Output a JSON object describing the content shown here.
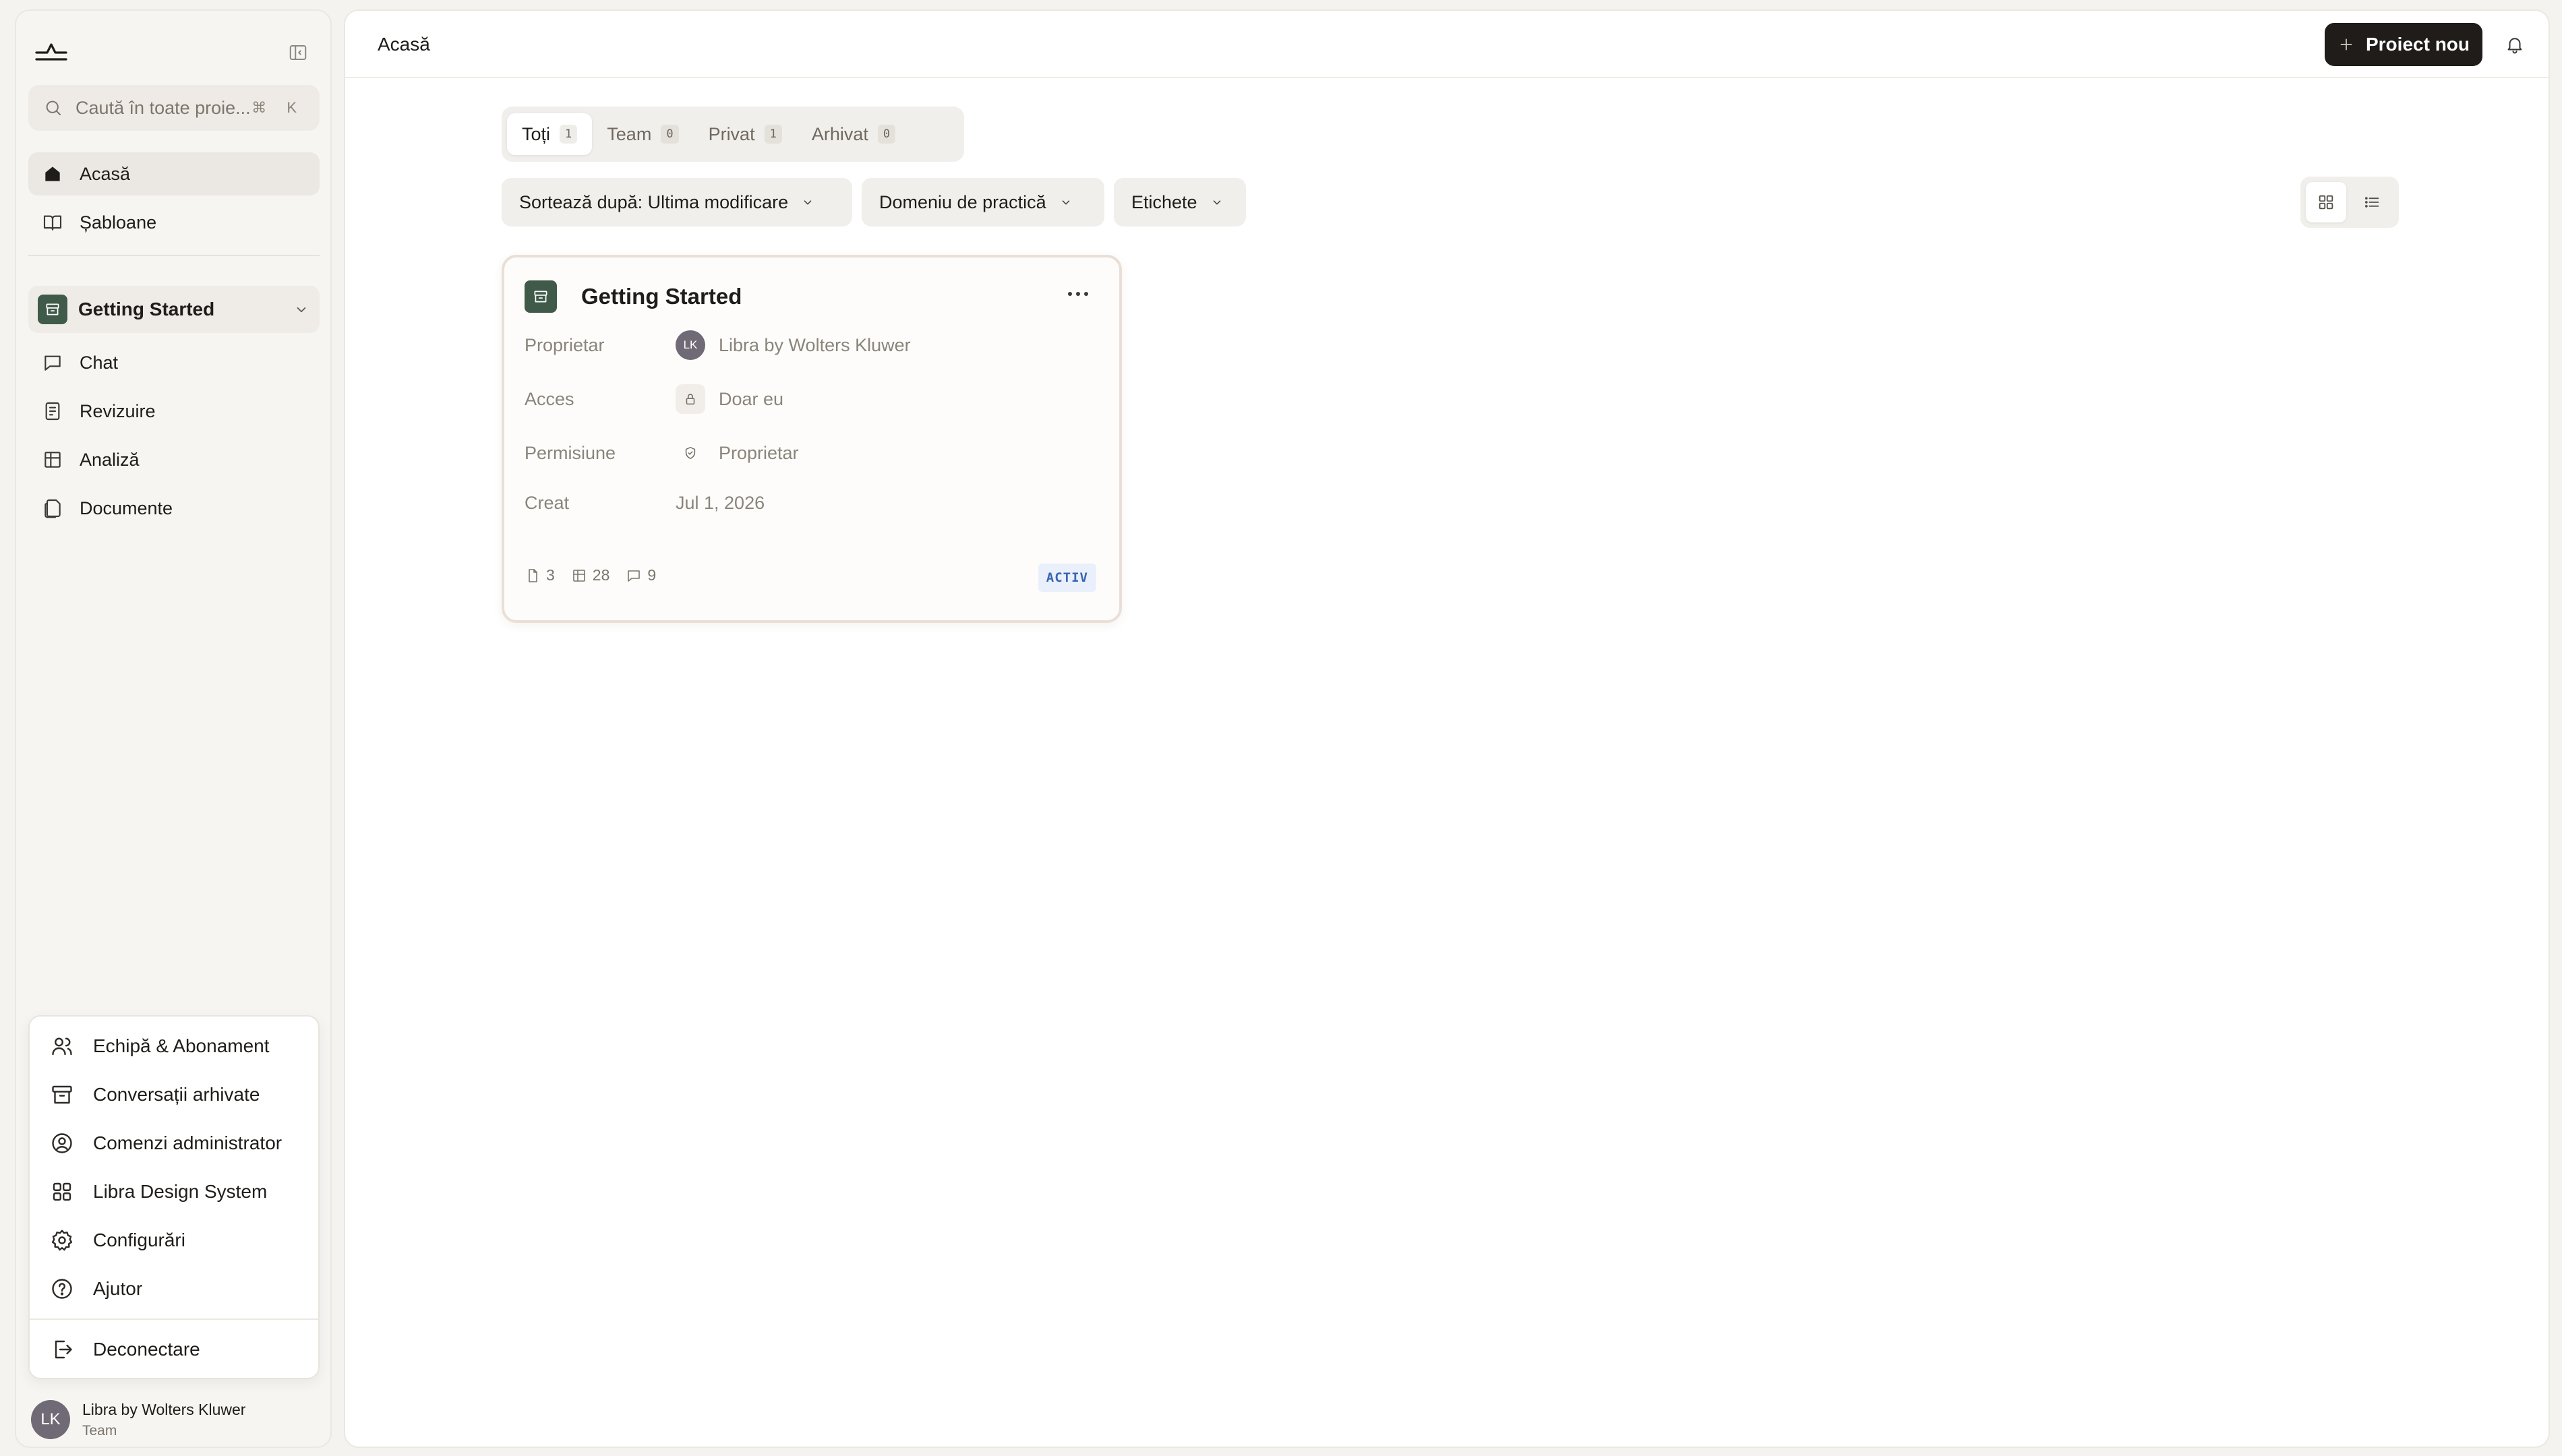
{
  "sidebar": {
    "search": {
      "placeholder": "Caută în toate proie...",
      "shortcut": "⌘ K"
    },
    "nav": [
      {
        "label": "Acasă",
        "icon": "home-icon",
        "active": true
      },
      {
        "label": "Șabloane",
        "icon": "book-icon",
        "active": false
      }
    ],
    "project": {
      "name": "Getting Started",
      "icon": "archive-box-icon"
    },
    "project_nav": [
      {
        "label": "Chat",
        "icon": "chat-icon"
      },
      {
        "label": "Revizuire",
        "icon": "review-icon"
      },
      {
        "label": "Analiză",
        "icon": "table-icon"
      },
      {
        "label": "Documente",
        "icon": "documents-icon"
      }
    ],
    "menu": [
      {
        "label": "Echipă & Abonament",
        "icon": "users-icon"
      },
      {
        "label": "Conversații arhivate",
        "icon": "archive-icon"
      },
      {
        "label": "Comenzi administrator",
        "icon": "user-circle-icon"
      },
      {
        "label": "Libra Design System",
        "icon": "grid-icon"
      },
      {
        "label": "Configurări",
        "icon": "gear-icon"
      },
      {
        "label": "Ajutor",
        "icon": "help-icon"
      }
    ],
    "logout": {
      "label": "Deconectare",
      "icon": "logout-icon"
    },
    "user": {
      "initials": "LK",
      "name": "Libra by Wolters Kluwer",
      "team": "Team"
    }
  },
  "header": {
    "title": "Acasă",
    "new_project_label": "Proiect nou"
  },
  "tabs": [
    {
      "label": "Toți",
      "count": "1",
      "active": true
    },
    {
      "label": "Team",
      "count": "0",
      "active": false
    },
    {
      "label": "Privat",
      "count": "1",
      "active": false
    },
    {
      "label": "Arhivat",
      "count": "0",
      "active": false
    }
  ],
  "filters": {
    "sort": "Sortează după: Ultima modificare",
    "practice": "Domeniu de practică",
    "tags": "Etichete"
  },
  "view_mode": "grid",
  "project_card": {
    "title": "Getting Started",
    "owner_label": "Proprietar",
    "owner_initials": "LK",
    "owner_value": "Libra by Wolters Kluwer",
    "access_label": "Acces",
    "access_value": "Doar eu",
    "permission_label": "Permisiune",
    "permission_value": "Proprietar",
    "created_label": "Creat",
    "created_value": "Jul 1, 2026",
    "stats": {
      "documents": "3",
      "tables": "28",
      "chats": "9"
    },
    "status": "ACTIV"
  },
  "colors": {
    "accent_dark": "#1f1c19",
    "project_badge": "#3f5a48",
    "status_badge_bg": "#eaf0fb",
    "status_badge_text": "#3b64b3"
  }
}
